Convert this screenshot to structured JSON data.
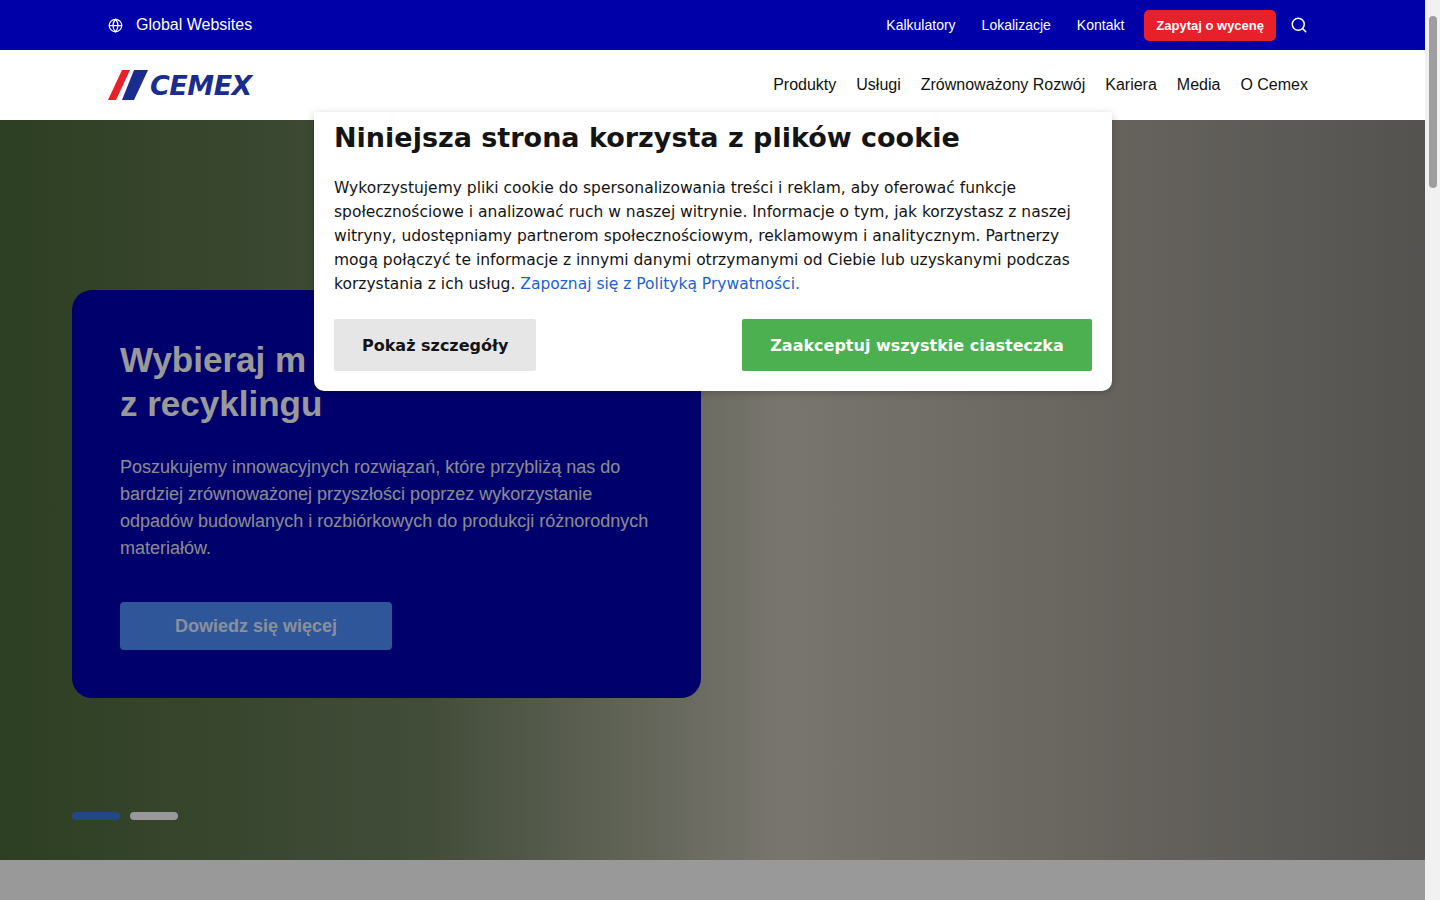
{
  "topbar": {
    "region": "Global Websites",
    "links": [
      "Kalkulatory",
      "Lokalizacje",
      "Kontakt"
    ],
    "cta": "Zapytaj o wycenę"
  },
  "header": {
    "logo": "CEMEX",
    "nav": [
      "Produkty",
      "Usługi",
      "Zrównoważony Rozwój",
      "Kariera",
      "Media",
      "O Cemex"
    ]
  },
  "hero": {
    "title_lines": [
      "Wybieraj m",
      "z recyklingu"
    ],
    "text": "Poszukujemy innowacyjnych rozwiązań, które przybliżą nas do bardziej zrównoważonej przyszłości poprzez wykorzystanie odpadów budowlanych i rozbiórkowych do produkcji różnorodnych materiałów.",
    "button": "Dowiedz się więcej",
    "slides": [
      {
        "selected": true
      },
      {
        "selected": false
      }
    ]
  },
  "cookie_dialog": {
    "title": "Niniejsza strona korzysta z plików cookie",
    "text": "Wykorzystujemy pliki cookie do spersonalizowania treści i reklam, aby oferować funkcje społecznościowe i analizować ruch w naszej witrynie. Informacje o tym, jak korzystasz z naszej witryny, udostępniamy partnerom społecznościowym, reklamowym i analitycznym. Partnerzy mogą połączyć te informacje z innymi danymi otrzymanymi od Ciebie lub uzyskanymi podczas korzystania z ich usług.",
    "link": "Zapoznaj się z Polityką Prywatności.",
    "buttons": [
      {
        "label": "Pokaż szczegóły",
        "kind": "secondary"
      },
      {
        "label": "Zaakceptuj wszystkie ciasteczka",
        "kind": "primary"
      }
    ]
  }
}
